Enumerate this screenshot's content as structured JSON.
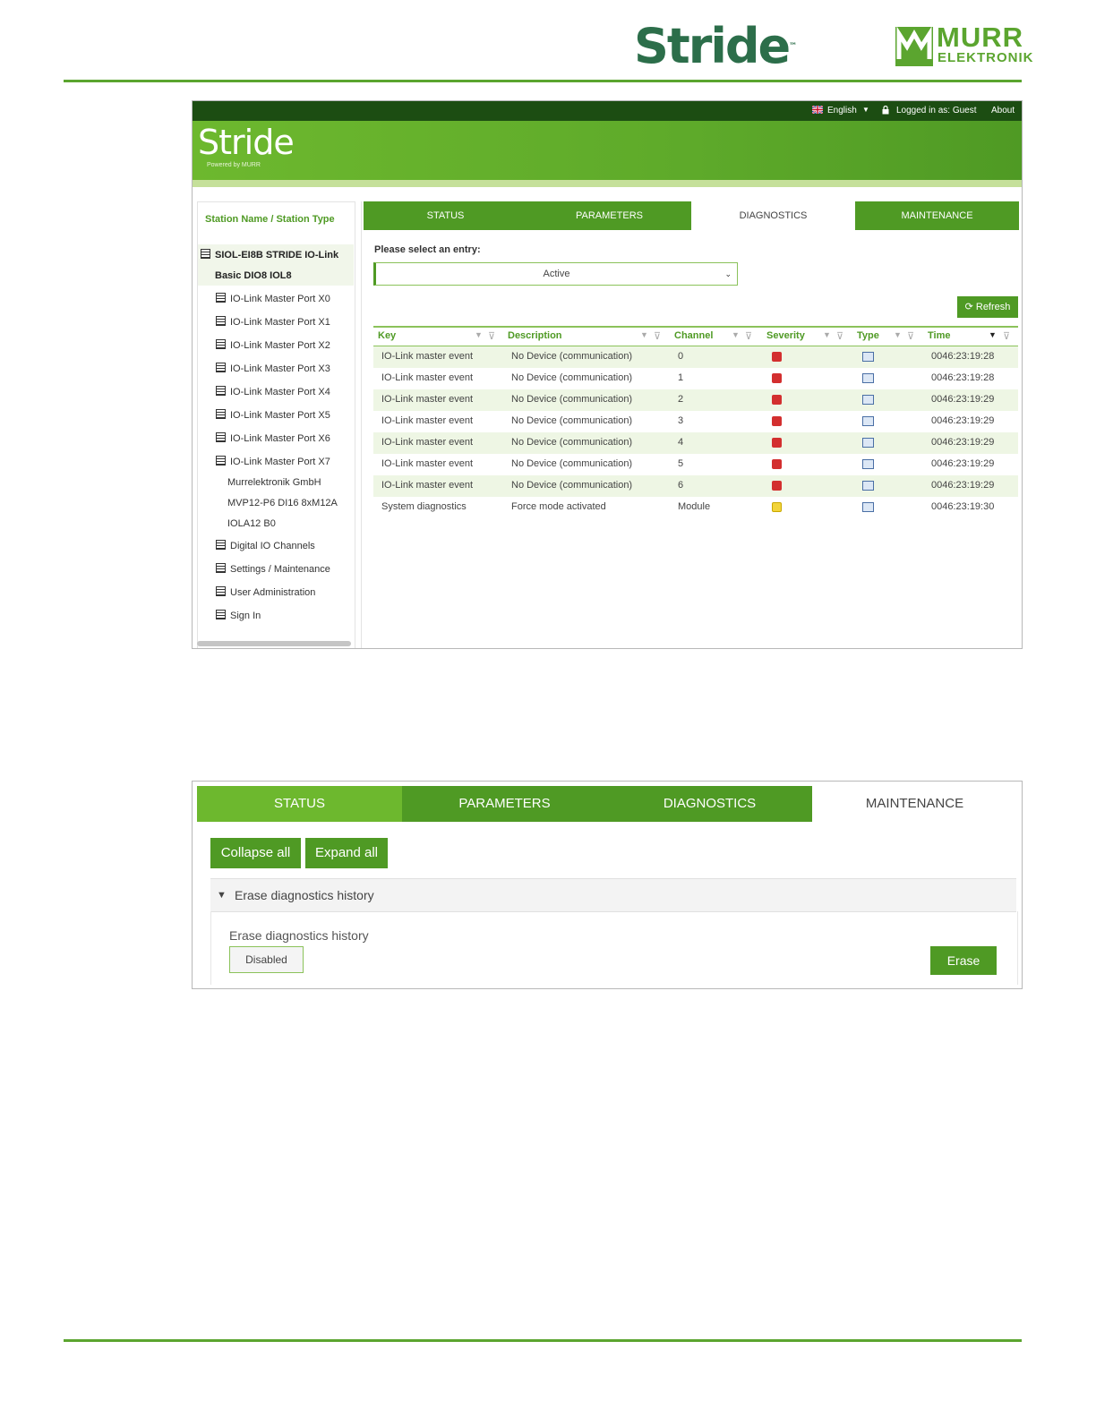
{
  "page_header": {
    "stride_logo": "Stride",
    "stride_tm": "™",
    "murr_logo_line1": "MURR",
    "murr_logo_line2": "ELEKTRONIK"
  },
  "screenshot_diagnostics": {
    "topbar": {
      "language": "English",
      "login_status": "Logged in as: Guest",
      "about": "About"
    },
    "brand": {
      "name": "Stride",
      "powered_by": "Powered by MURR"
    },
    "sidebar": {
      "header": "Station Name / Station Type",
      "station_line1": "SIOL-EI8B STRIDE IO-Link",
      "station_line2": "Basic DIO8 IOL8",
      "ports": [
        "IO-Link Master Port X0",
        "IO-Link Master Port X1",
        "IO-Link Master Port X2",
        "IO-Link Master Port X3",
        "IO-Link Master Port X4",
        "IO-Link Master Port X5",
        "IO-Link Master Port X6",
        "IO-Link Master Port X7"
      ],
      "device_lines": [
        "Murrelektronik GmbH",
        "MVP12-P6 DI16 8xM12A",
        "IOLA12 B0"
      ],
      "items": [
        "Digital IO Channels",
        "Settings / Maintenance",
        "User Administration",
        "Sign In"
      ]
    },
    "tabs": [
      "STATUS",
      "PARAMETERS",
      "DIAGNOSTICS",
      "MAINTENANCE"
    ],
    "active_tab": "DIAGNOSTICS",
    "select_label": "Please select an entry:",
    "select_value": "Active",
    "refresh_label": "Refresh",
    "columns": [
      "Key",
      "Description",
      "Channel",
      "Severity",
      "Type",
      "Time"
    ],
    "rows": [
      {
        "key": "IO-Link master event",
        "description": "No Device (communication)",
        "channel": "0",
        "severity": "error",
        "type": "message",
        "time": "0046:23:19:28"
      },
      {
        "key": "IO-Link master event",
        "description": "No Device (communication)",
        "channel": "1",
        "severity": "error",
        "type": "message",
        "time": "0046:23:19:28"
      },
      {
        "key": "IO-Link master event",
        "description": "No Device (communication)",
        "channel": "2",
        "severity": "error",
        "type": "message",
        "time": "0046:23:19:29"
      },
      {
        "key": "IO-Link master event",
        "description": "No Device (communication)",
        "channel": "3",
        "severity": "error",
        "type": "message",
        "time": "0046:23:19:29"
      },
      {
        "key": "IO-Link master event",
        "description": "No Device (communication)",
        "channel": "4",
        "severity": "error",
        "type": "message",
        "time": "0046:23:19:29"
      },
      {
        "key": "IO-Link master event",
        "description": "No Device (communication)",
        "channel": "5",
        "severity": "error",
        "type": "message",
        "time": "0046:23:19:29"
      },
      {
        "key": "IO-Link master event",
        "description": "No Device (communication)",
        "channel": "6",
        "severity": "error",
        "type": "message",
        "time": "0046:23:19:29"
      },
      {
        "key": "System diagnostics",
        "description": "Force mode activated",
        "channel": "Module",
        "severity": "warning",
        "type": "message",
        "time": "0046:23:19:30"
      }
    ]
  },
  "screenshot_maintenance": {
    "tabs": [
      "STATUS",
      "PARAMETERS",
      "DIAGNOSTICS",
      "MAINTENANCE"
    ],
    "active_tab": "MAINTENANCE",
    "collapse_all": "Collapse all",
    "expand_all": "Expand all",
    "section_title": "Erase diagnostics history",
    "field_label": "Erase diagnostics history",
    "field_value": "Disabled",
    "erase_button": "Erase"
  },
  "colors": {
    "brand_green": "#4f9a24",
    "light_green": "#6db82e",
    "dark_green": "#1c4d12",
    "error_red": "#d32f2f",
    "warning_yellow": "#f2d43a"
  }
}
